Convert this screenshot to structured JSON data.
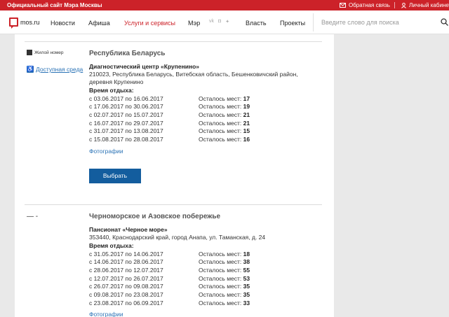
{
  "topbar": {
    "site_title": "Официальный сайт Мэра Москвы",
    "feedback": "Обратная связь",
    "cabinet": "Личный кабинет"
  },
  "nav": {
    "logo_text": "mos.ru",
    "items": [
      "Новости",
      "Афиша",
      "Услуги и сервисы",
      "Мэр",
      "Власть",
      "Проекты"
    ],
    "active_item": "Услуги и сервисы",
    "search_placeholder": "Введите слово для поиска"
  },
  "sidebar": {
    "housing_label": "Жилой номер",
    "accessible_link": "Доступная среда",
    "dash": "— -"
  },
  "listings": [
    {
      "region": "Республика Беларусь",
      "center": "Диагностический центр «Крупенино»",
      "address": "210023, Республика Беларусь, Витебская область, Бешенковичский район, деревня Крупенино",
      "period_label": "Время отдыха:",
      "seats_label": "Осталось мест:",
      "periods": [
        {
          "range": "с 03.06.2017 по 16.06.2017",
          "seats": "17"
        },
        {
          "range": "с 17.06.2017 по 30.06.2017",
          "seats": "19"
        },
        {
          "range": "с 02.07.2017 по 15.07.2017",
          "seats": "21"
        },
        {
          "range": "с 16.07.2017 по 29.07.2017",
          "seats": "21"
        },
        {
          "range": "с 31.07.2017 по 13.08.2017",
          "seats": "15"
        },
        {
          "range": "с 15.08.2017 по 28.08.2017",
          "seats": "16"
        }
      ],
      "photos": "Фотографии",
      "select": "Выбрать"
    },
    {
      "region": "Черноморское и Азовское побережье",
      "center": "Пансионат «Черное море»",
      "address": "353440, Краснодарский край, город Анапа, ул. Таманская, д. 24",
      "period_label": "Время отдыха:",
      "seats_label": "Осталось мест:",
      "periods": [
        {
          "range": "с 31.05.2017 по 14.06.2017",
          "seats": "18"
        },
        {
          "range": "с 14.06.2017 по 28.06.2017",
          "seats": "38"
        },
        {
          "range": "с 28.06.2017 по 12.07.2017",
          "seats": "55"
        },
        {
          "range": "с 12.07.2017 по 26.07.2017",
          "seats": "53"
        },
        {
          "range": "с 26.07.2017 по 09.08.2017",
          "seats": "35"
        },
        {
          "range": "с 09.08.2017 по 23.08.2017",
          "seats": "35"
        },
        {
          "range": "с 23.08.2017 по 06.09.2017",
          "seats": "33"
        }
      ],
      "photos": "Фотографии"
    }
  ],
  "colors": {
    "brand_red": "#cc2229",
    "link_blue": "#2b73b6",
    "button_blue": "#135d9e"
  }
}
